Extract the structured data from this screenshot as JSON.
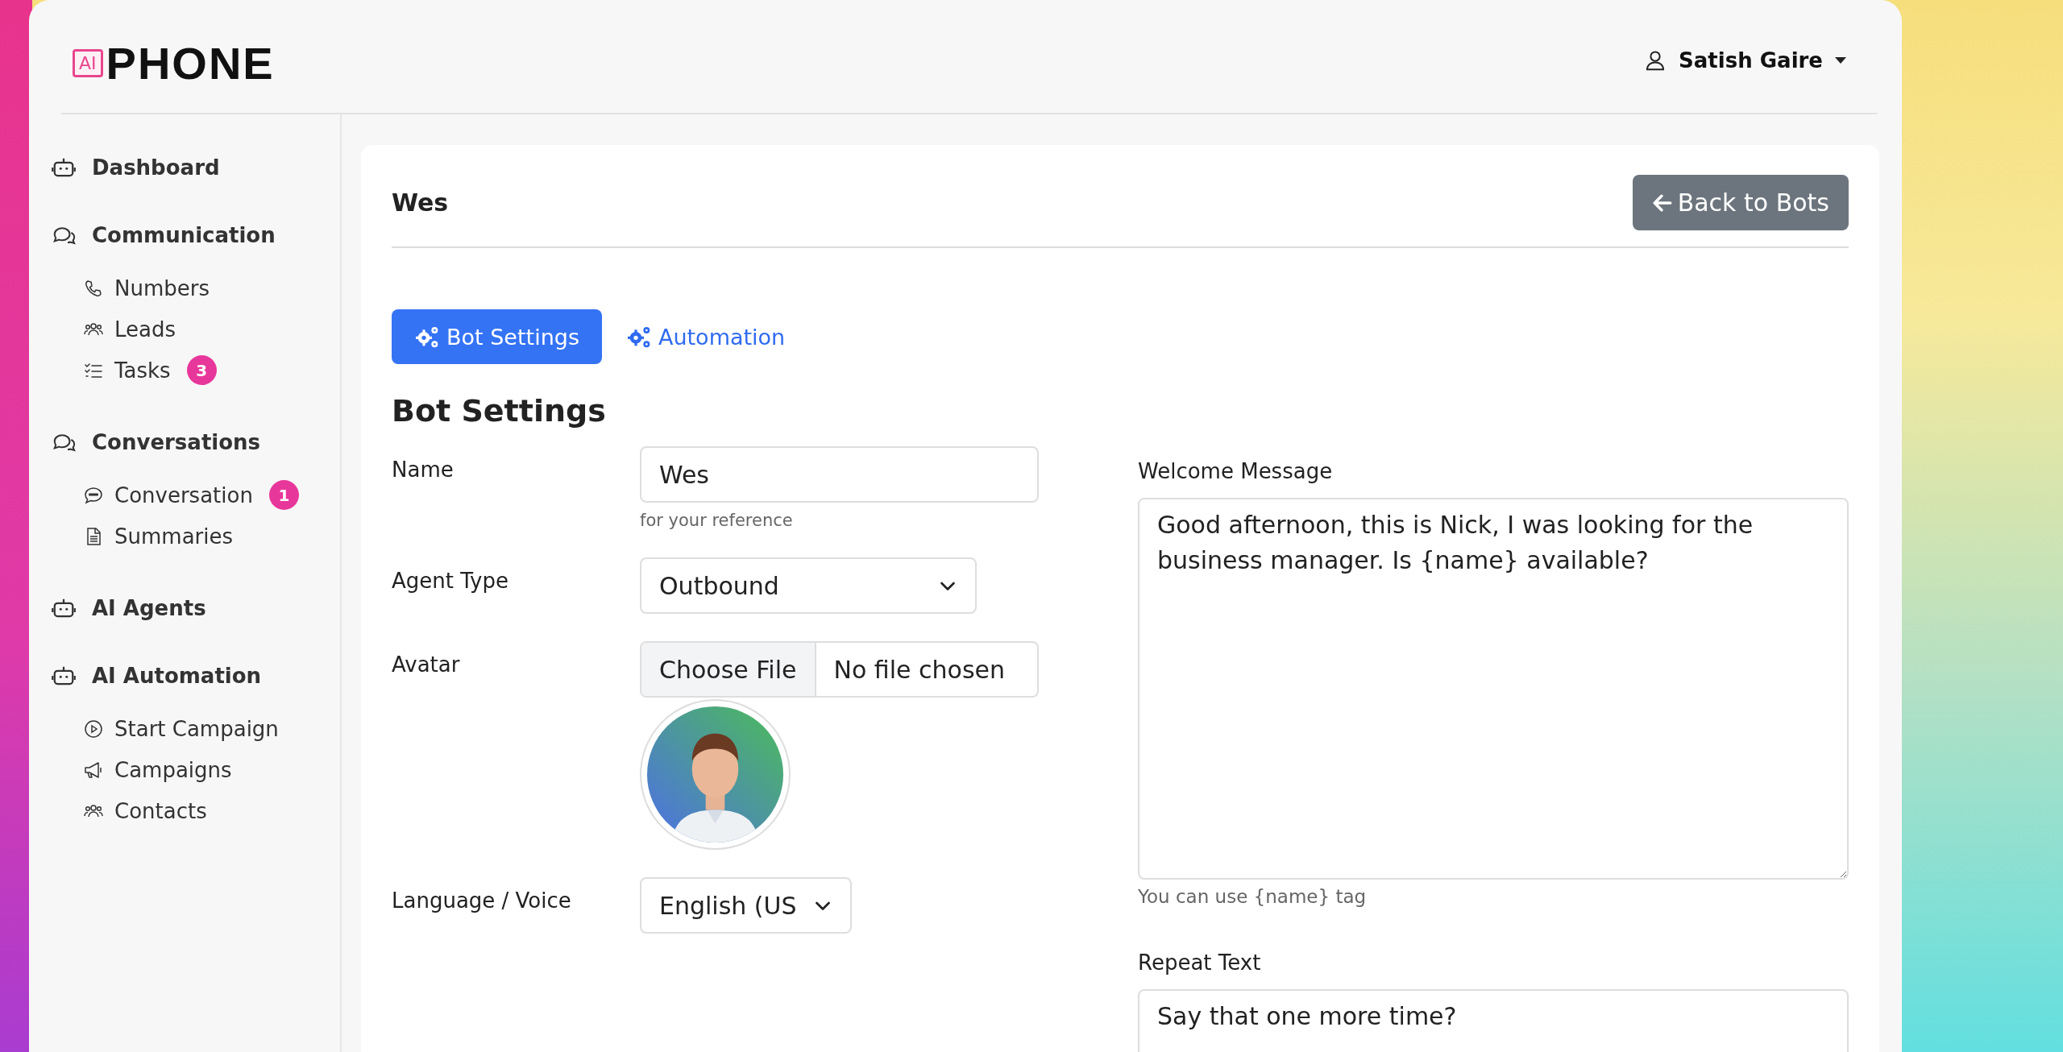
{
  "header": {
    "logo": {
      "badge": "AI",
      "word": "PHONE"
    },
    "user": {
      "name": "Satish Gaire"
    }
  },
  "sidebar": {
    "sections": [
      {
        "label": "Dashboard"
      },
      {
        "label": "Communication",
        "children": [
          {
            "label": "Numbers"
          },
          {
            "label": "Leads"
          },
          {
            "label": "Tasks",
            "badge": "3"
          }
        ]
      },
      {
        "label": "Conversations",
        "children": [
          {
            "label": "Conversation",
            "badge": "1"
          },
          {
            "label": "Summaries"
          }
        ]
      },
      {
        "label": "AI Agents"
      },
      {
        "label": "AI Automation",
        "children": [
          {
            "label": "Start Campaign"
          },
          {
            "label": "Campaigns"
          },
          {
            "label": "Contacts"
          }
        ]
      }
    ]
  },
  "card": {
    "title": "Wes",
    "back_button": "Back to Bots",
    "tabs": [
      {
        "label": "Bot Settings",
        "selected": true
      },
      {
        "label": "Automation",
        "selected": false
      }
    ],
    "heading": "Bot Settings",
    "fields": [
      {
        "kind": "text",
        "label": "Name",
        "value": "Wes",
        "help": "for your reference"
      },
      {
        "kind": "select",
        "label": "Agent Type",
        "value": "Outbound"
      },
      {
        "kind": "file",
        "label": "Avatar",
        "button": "Choose File",
        "status": "No file chosen"
      },
      {
        "kind": "select",
        "label": "Language / Voice",
        "value": "English (US"
      }
    ],
    "messages": [
      {
        "label": "Welcome Message",
        "value": "Good afternoon, this is Nick, I was looking for the business manager. Is {name} available?",
        "help": "You can use {name} tag"
      },
      {
        "label": "Repeat Text",
        "value": "Say that one more time?"
      }
    ]
  }
}
